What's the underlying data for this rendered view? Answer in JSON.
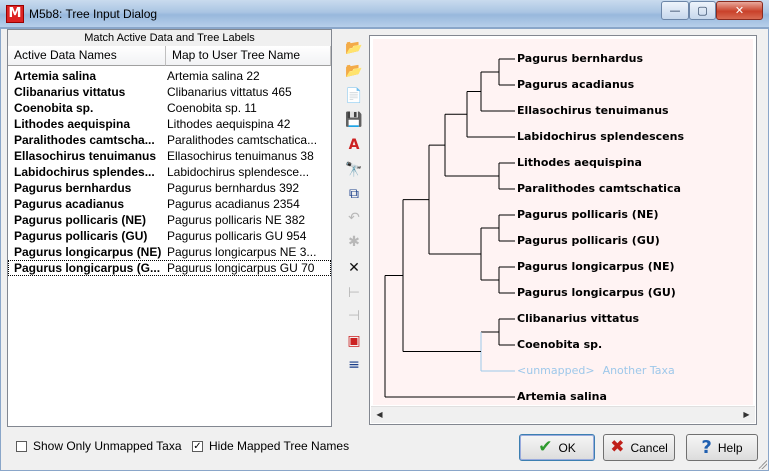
{
  "window": {
    "title": "M5b8: Tree Input Dialog",
    "app_icon_letter": "M",
    "controls": {
      "minimize": "—",
      "maximize": "▢",
      "close": "✕"
    }
  },
  "left_panel": {
    "group_header": "Match Active Data and Tree Labels",
    "columns": [
      "Active Data Names",
      "Map to User Tree Name"
    ],
    "rows": [
      {
        "name": "Artemia salina",
        "map": "Artemia salina 22"
      },
      {
        "name": "Clibanarius vittatus",
        "map": "Clibanarius vittatus 465"
      },
      {
        "name": "Coenobita sp.",
        "map": "Coenobita sp. 11"
      },
      {
        "name": "Lithodes aequispina",
        "map": "Lithodes aequispina 42"
      },
      {
        "name": "Paralithodes camtscha...",
        "map": "Paralithodes camtschatica..."
      },
      {
        "name": "Ellasochirus tenuimanus",
        "map": "Ellasochirus tenuimanus 38"
      },
      {
        "name": "Labidochirus splendes...",
        "map": "Labidochirus splendesce..."
      },
      {
        "name": "Pagurus bernhardus",
        "map": "Pagurus bernhardus 392"
      },
      {
        "name": "Pagurus acadianus",
        "map": "Pagurus acadianus 2354"
      },
      {
        "name": "Pagurus pollicaris (NE)",
        "map": "Pagurus pollicaris NE 382"
      },
      {
        "name": "Pagurus pollicaris (GU)",
        "map": "Pagurus pollicaris GU 954"
      },
      {
        "name": "Pagurus longicarpus (NE)",
        "map": "Pagurus longicarpus NE 3..."
      },
      {
        "name": "Pagurus longicarpus (G...",
        "map": "Pagurus longicarpus GU 70"
      }
    ]
  },
  "toolbar": [
    {
      "name": "open-folder-icon",
      "glyph": "📂",
      "enabled": true
    },
    {
      "name": "open-recent-folder-icon",
      "glyph": "📂",
      "enabled": true
    },
    {
      "name": "page-icon",
      "glyph": "📄",
      "enabled": true
    },
    {
      "name": "save-icon",
      "glyph": "💾",
      "enabled": true
    },
    {
      "name": "auto-match-icon",
      "glyph": "A",
      "enabled": true
    },
    {
      "name": "find-icon",
      "glyph": "🔭",
      "enabled": true
    },
    {
      "name": "copy-icon",
      "glyph": "⧉",
      "enabled": true
    },
    {
      "name": "undo-icon",
      "glyph": "↶",
      "enabled": false
    },
    {
      "name": "bug-icon",
      "glyph": "✱",
      "enabled": false
    },
    {
      "name": "delete-icon",
      "glyph": "✕",
      "enabled": true
    },
    {
      "name": "tree-expand-icon",
      "glyph": "⊢",
      "enabled": false
    },
    {
      "name": "tree-collapse-icon",
      "glyph": "⊣",
      "enabled": false
    },
    {
      "name": "tree-frame-icon",
      "glyph": "▣",
      "enabled": true
    },
    {
      "name": "sort-icon",
      "glyph": "≡",
      "enabled": true
    }
  ],
  "tree": {
    "leaves": [
      {
        "label": "Pagurus bernhardus",
        "mapped": true
      },
      {
        "label": "Pagurus acadianus",
        "mapped": true
      },
      {
        "label": "Ellasochirus tenuimanus",
        "mapped": true
      },
      {
        "label": "Labidochirus splendescens",
        "mapped": true
      },
      {
        "label": "Lithodes aequispina",
        "mapped": true
      },
      {
        "label": "Paralithodes camtschatica",
        "mapped": true
      },
      {
        "label": "Pagurus pollicaris (NE)",
        "mapped": true
      },
      {
        "label": "Pagurus pollicaris (GU)",
        "mapped": true
      },
      {
        "label": "Pagurus longicarpus (NE)",
        "mapped": true
      },
      {
        "label": "Pagurus longicarpus (GU)",
        "mapped": true
      },
      {
        "label": "Clibanarius vittatus",
        "mapped": true
      },
      {
        "label": "Coenobita sp.",
        "mapped": true
      },
      {
        "label": "<unmapped>",
        "mapped": false,
        "extra": "Another Taxa"
      },
      {
        "label": "Artemia salina",
        "mapped": true
      }
    ]
  },
  "footer": {
    "show_only_unmapped": {
      "label": "Show Only Unmapped Taxa",
      "checked": false
    },
    "hide_mapped": {
      "label": "Hide Mapped Tree Names",
      "checked": true
    },
    "ok_label": "OK",
    "cancel_label": "Cancel",
    "help_label": "Help"
  },
  "colors": {
    "tree_background": "#fff3f3",
    "unmapped_text": "#9ec8ea",
    "ok_check": "#2e9a2e",
    "cancel_x": "#c0201a",
    "help_q": "#1f5fb0"
  }
}
